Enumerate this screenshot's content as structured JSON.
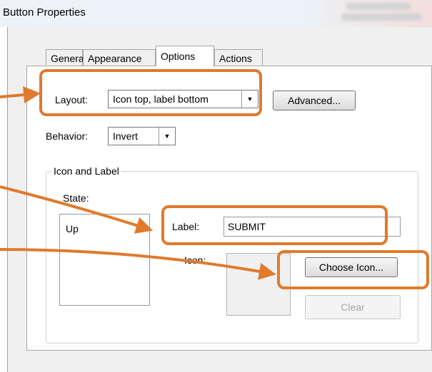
{
  "window": {
    "title": "Button Properties"
  },
  "tabs": [
    "General",
    "Appearance",
    "Options",
    "Actions"
  ],
  "active_tab": "Options",
  "layout": {
    "label": "Layout:",
    "value": "Icon top, label bottom"
  },
  "advanced_button": "Advanced...",
  "behavior": {
    "label": "Behavior:",
    "value": "Invert"
  },
  "icon_and_label": {
    "group_title": "Icon and Label",
    "state_label": "State:",
    "states": [
      "Up"
    ],
    "label_field": {
      "label": "Label:",
      "value": "SUBMIT"
    },
    "icon_label": "Icon:",
    "choose_icon_button": "Choose Icon...",
    "clear_button": "Clear"
  },
  "colors": {
    "highlight": "#e07a2c",
    "title_bar": "#ecf2f8"
  },
  "icons": [
    "dropdown-arrow-icon",
    "callout-arrow-icon"
  ]
}
